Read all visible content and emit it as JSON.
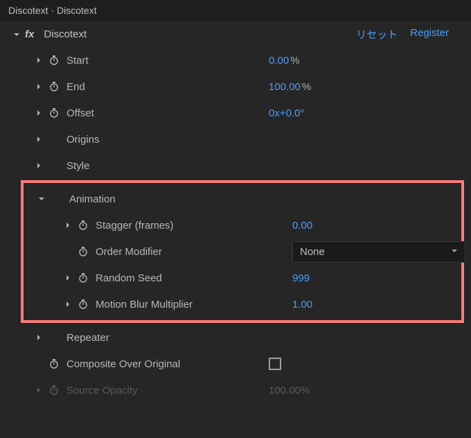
{
  "panel": {
    "tabTitle": "Discotext · Discotext"
  },
  "effect": {
    "name": "Discotext",
    "reset": "リセット",
    "register": "Register"
  },
  "props": {
    "start": {
      "label": "Start",
      "value": "0.00",
      "unit": "%"
    },
    "end": {
      "label": "End",
      "value": "100.00",
      "unit": "%"
    },
    "offset": {
      "label": "Offset",
      "value": "0x+0.0°"
    },
    "origins": {
      "label": "Origins"
    },
    "style": {
      "label": "Style"
    },
    "animation": {
      "label": "Animation",
      "stagger": {
        "label": "Stagger (frames)",
        "value": "0.00"
      },
      "orderModifier": {
        "label": "Order Modifier",
        "value": "None"
      },
      "randomSeed": {
        "label": "Random Seed",
        "value": "999"
      },
      "motionBlur": {
        "label": "Motion Blur Multiplier",
        "value": "1.00"
      }
    },
    "repeater": {
      "label": "Repeater"
    },
    "composite": {
      "label": "Composite Over Original"
    },
    "sourceOpacity": {
      "label": "Source Opacity",
      "value": "100.00",
      "unit": "%"
    }
  }
}
